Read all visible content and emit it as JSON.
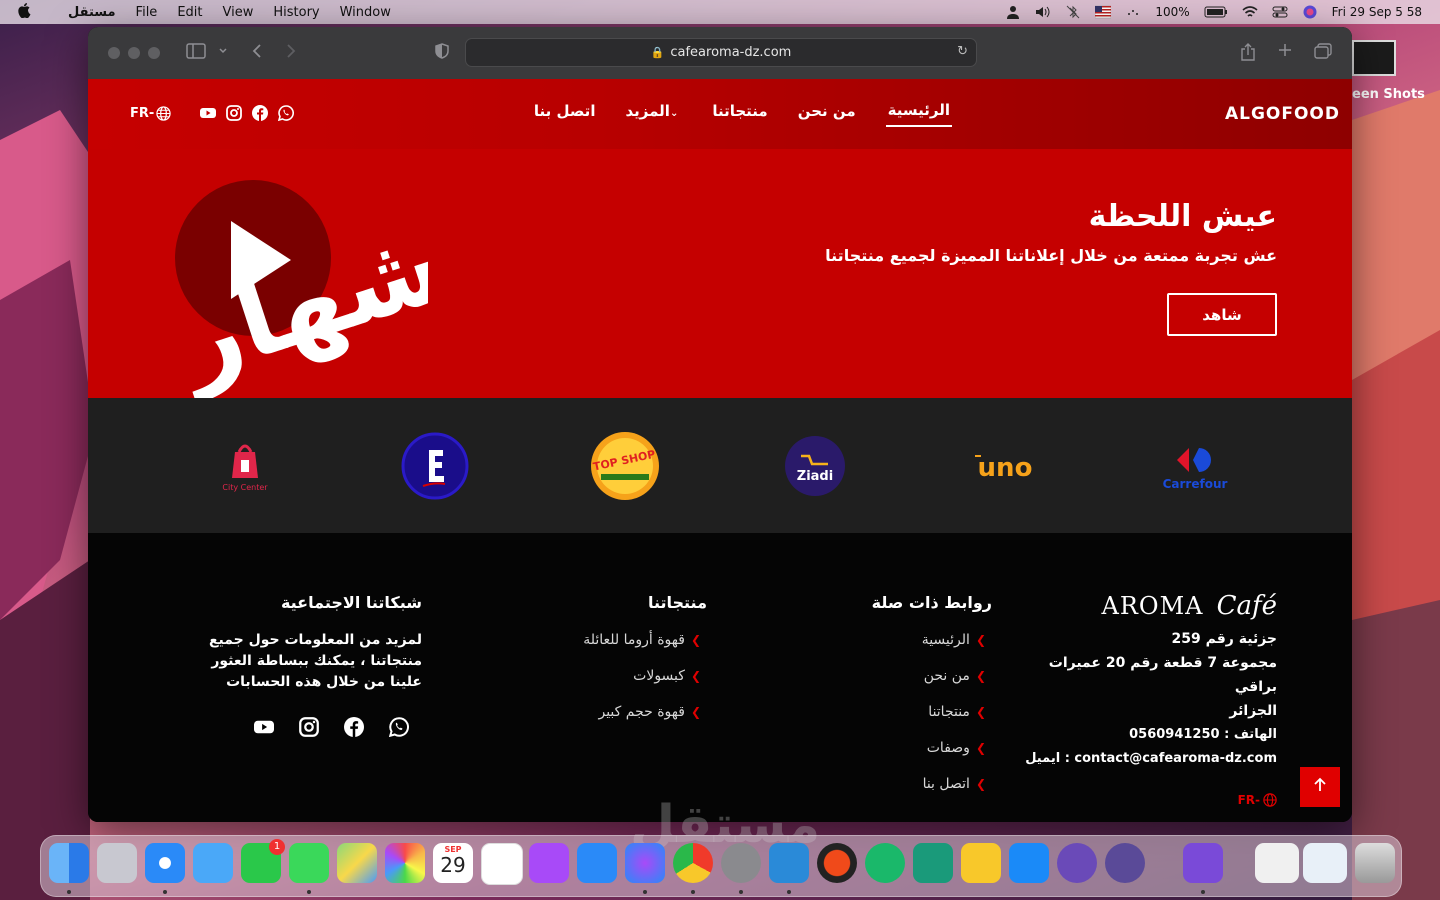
{
  "menubar": {
    "app_name": "مستقل",
    "menus": [
      "File",
      "Edit",
      "View",
      "History",
      "Window"
    ],
    "battery": "100%",
    "datetime": "Fri 29 Sep  5 58"
  },
  "desktop": {
    "icon_label": "een Shots"
  },
  "browser": {
    "url": "cafearoma-dz.com"
  },
  "nav": {
    "brand": "ALGOFOOD",
    "links": [
      "الرئيسية",
      "من نحن",
      "منتجاتنا",
      "المزيد",
      "اتصل بنا"
    ],
    "lang": "FR-"
  },
  "hero": {
    "title": "عيش اللحظة",
    "subtitle": "عش تجربة ممتعة من خلال إعلاناتنا المميزة لجميع منتجاتنا",
    "button": "شاهد",
    "art_text": "إشهار"
  },
  "partners": [
    "City Center",
    "",
    "TOP SHOP",
    "Ziadi",
    "uno",
    "Carrefour"
  ],
  "footer": {
    "brand_a": "AROMA",
    "brand_b": "Café",
    "address_lines": [
      "259 جزئية رقم",
      "مجموعة 7 قطعة رقم 20 عميرات براقي",
      "الجزائر"
    ],
    "phone": "الهاتف : 0560941250",
    "email": "ايميل : contact@cafearoma-dz.com",
    "lang": "FR-",
    "links_title": "روابط ذات صلة",
    "links": [
      "الرئيسية",
      "من نحن",
      "منتجاتنا",
      "وصفات",
      "اتصل بنا"
    ],
    "products_title": "منتجاتنا",
    "products": [
      "قهوة أروما للعائلة",
      "كبسولات",
      "قهوة حجم كبير"
    ],
    "social_title": "شبكاتنا الاجتماعية",
    "social_text": "لمزيد من المعلومات حول جميع منتجاتنا ، يمكنك ببساطة العثور علينا من خلال هذه الحسابات"
  },
  "dock": {
    "calendar_month": "SEP",
    "calendar_day": "29",
    "facetime_badge": "1"
  },
  "watermark": "مستقل",
  "colors": {
    "brand_red": "#c50000",
    "accent_red": "#e00000",
    "footer_bg": "#050505",
    "logo_band": "#1f1f1f"
  }
}
